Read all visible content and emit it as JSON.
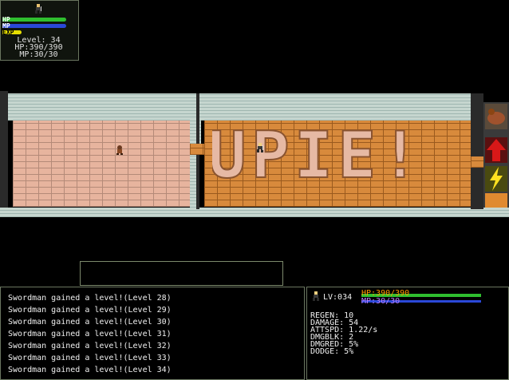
{
  "status": {
    "hp_label": "HP",
    "mp_label": "MP",
    "exp_label": "EXP",
    "hp_fraction": 1.0,
    "mp_fraction": 1.0,
    "exp_fraction": 0.3,
    "level_text": "Level: 34",
    "hp_text": "HP:390/390",
    "mp_text": "MP:30/30",
    "colors": {
      "hp": "#2fbf2f",
      "mp": "#2a48d8",
      "exp": "#e8e000"
    }
  },
  "map": {
    "player_icon": "swordsman-player-icon",
    "enemy_icon": "goblin-enemy-icon",
    "floor_text": "UPIE!"
  },
  "skills": [
    {
      "name": "summon-beast-skill-icon"
    },
    {
      "name": "power-up-arrow-skill-icon"
    },
    {
      "name": "lightning-skill-icon"
    }
  ],
  "message_box": {
    "text": ""
  },
  "log": [
    "Swordman gained a level!(Level 28)",
    "Swordman gained a level!(Level 29)",
    "Swordman gained a level!(Level 30)",
    "Swordman gained a level!(Level 31)",
    "Swordman gained a level!(Level 32)",
    "Swordman gained a level!(Level 33)",
    "Swordman gained a level!(Level 34)"
  ],
  "character": {
    "level_text": "LV:034",
    "hp_text": "HP:390/390",
    "mp_text": "MP:30/30",
    "stats": [
      "REGEN: 10",
      "DAMAGE: 54",
      "ATTSPD: 1.22/s",
      "DMGBLK: 2",
      "DMGRED: 5%",
      "DODGE: 5%"
    ]
  }
}
